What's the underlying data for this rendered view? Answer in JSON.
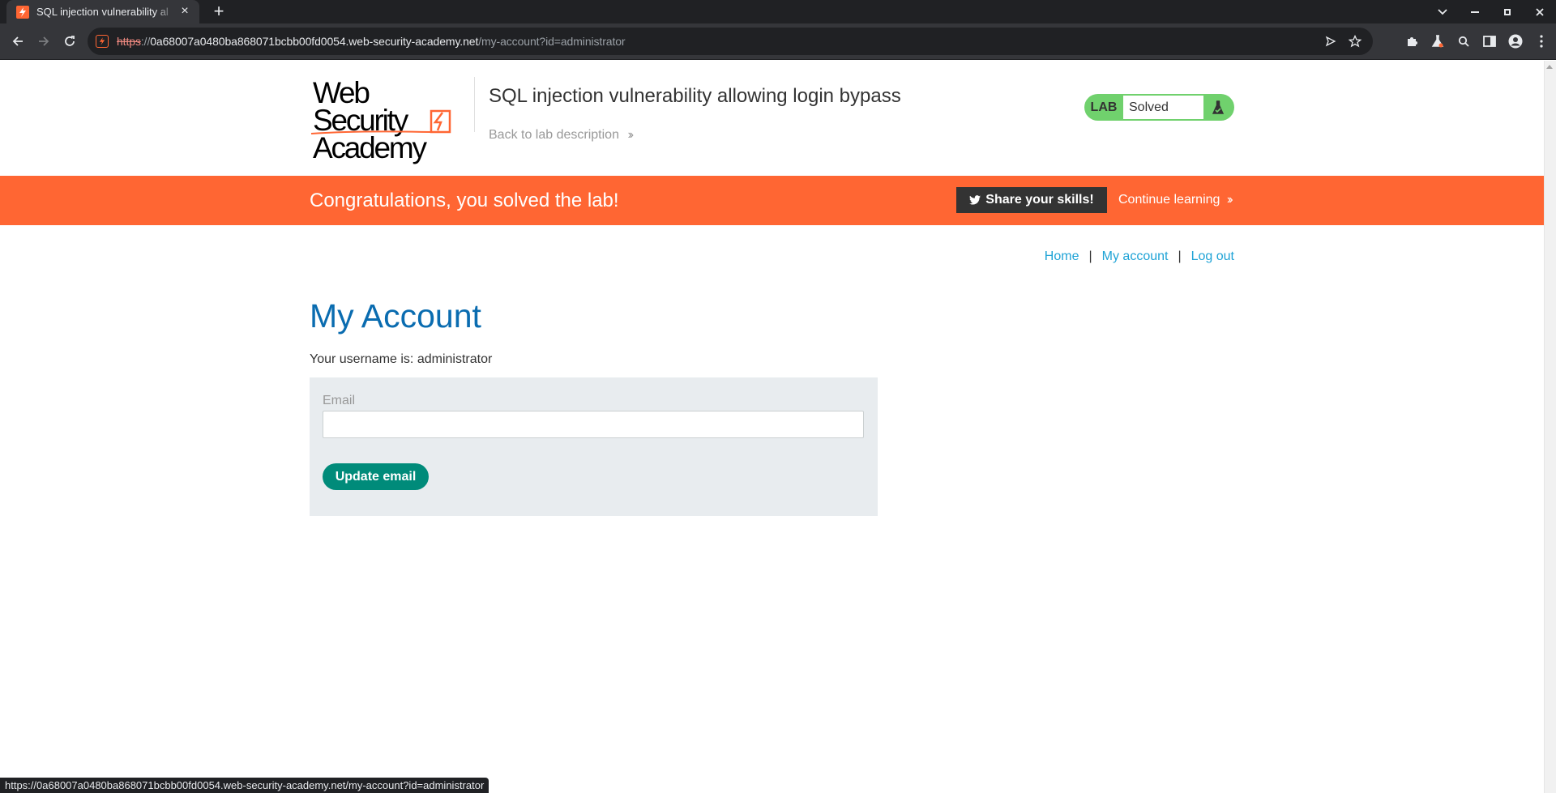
{
  "browser": {
    "tab_title": "SQL injection vulnerability al",
    "url_scheme": "https",
    "url_sep": "://",
    "url_host": "0a68007a0480ba868071bcbb00fd0054.web-security-academy.net",
    "url_path": "/my-account?id=administrator",
    "status_url": "https://0a68007a0480ba868071bcbb00fd0054.web-security-academy.net/my-account?id=administrator"
  },
  "header": {
    "logo_line1": "Web Security",
    "logo_line2": "Academy",
    "lab_title": "SQL injection vulnerability allowing login bypass",
    "back_link": "Back to lab description",
    "lab_label": "LAB",
    "lab_state": "Solved"
  },
  "banner": {
    "message": "Congratulations, you solved the lab!",
    "share_label": "Share your skills!",
    "continue_label": "Continue learning"
  },
  "nav": {
    "home": "Home",
    "separator": "|",
    "my_account": "My account",
    "log_out": "Log out"
  },
  "main": {
    "heading": "My Account",
    "username_text": "Your username is: administrator",
    "email_label": "Email",
    "email_value": "",
    "update_button": "Update email"
  },
  "colors": {
    "accent": "#ff6633",
    "heading": "#0a6cb0",
    "link": "#1fa3d6",
    "button": "#008b7a",
    "lab_badge": "#70d16d"
  }
}
